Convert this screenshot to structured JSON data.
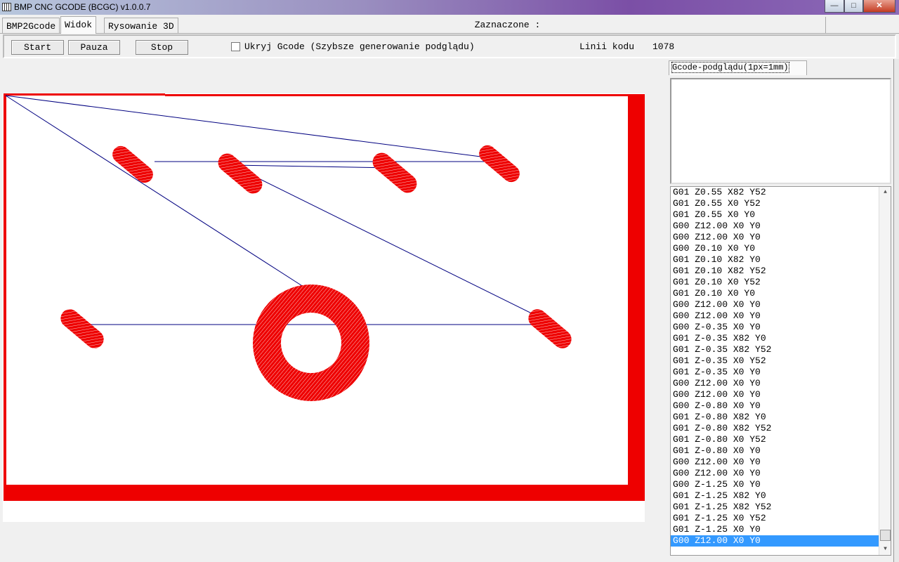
{
  "window": {
    "title": "BMP CNC GCODE (BCGC) v1.0.0.7",
    "minimize": "—",
    "maximize": "□",
    "close": "✕"
  },
  "tabs": [
    {
      "label": "BMP2Gcode"
    },
    {
      "label": "Widok",
      "active": true
    },
    {
      "label": "Rysowanie 3D"
    }
  ],
  "selected_label": "Zaznaczone :",
  "toolbar": {
    "start": "Start",
    "pause": "Pauza",
    "stop": "Stop",
    "hide_gcode": "Ukryj Gcode (Szybsze generowanie podglądu)",
    "hide_gcode_checked": false,
    "lines_label": "Linii kodu",
    "lines_value": "1078"
  },
  "right_panel": {
    "tab": "Gcode-podglądu(1px=1mm)",
    "gcode_lines": [
      "G01 Z0.55 X82 Y52",
      "G01 Z0.55 X0 Y52",
      "G01 Z0.55 X0 Y0",
      "G00 Z12.00 X0 Y0",
      "G00 Z12.00 X0 Y0",
      "G00 Z0.10 X0 Y0",
      "G01 Z0.10 X82 Y0",
      "G01 Z0.10 X82 Y52",
      "G01 Z0.10 X0 Y52",
      "G01 Z0.10 X0 Y0",
      "G00 Z12.00 X0 Y0",
      "G00 Z12.00 X0 Y0",
      "G00 Z-0.35 X0 Y0",
      "G01 Z-0.35 X82 Y0",
      "G01 Z-0.35 X82 Y52",
      "G01 Z-0.35 X0 Y52",
      "G01 Z-0.35 X0 Y0",
      "G00 Z12.00 X0 Y0",
      "G00 Z12.00 X0 Y0",
      "G00 Z-0.80 X0 Y0",
      "G01 Z-0.80 X82 Y0",
      "G01 Z-0.80 X82 Y52",
      "G01 Z-0.80 X0 Y52",
      "G01 Z-0.80 X0 Y0",
      "G00 Z12.00 X0 Y0",
      "G00 Z12.00 X0 Y0",
      "G00 Z-1.25 X0 Y0",
      "G01 Z-1.25 X82 Y0",
      "G01 Z-1.25 X82 Y52",
      "G01 Z-1.25 X0 Y52",
      "G01 Z-1.25 X0 Y0",
      "G00 Z12.00 X0 Y0"
    ],
    "selected_index": 31
  },
  "colors": {
    "cut": "#ee0000",
    "travel": "#000080",
    "selection": "#3399ff"
  }
}
